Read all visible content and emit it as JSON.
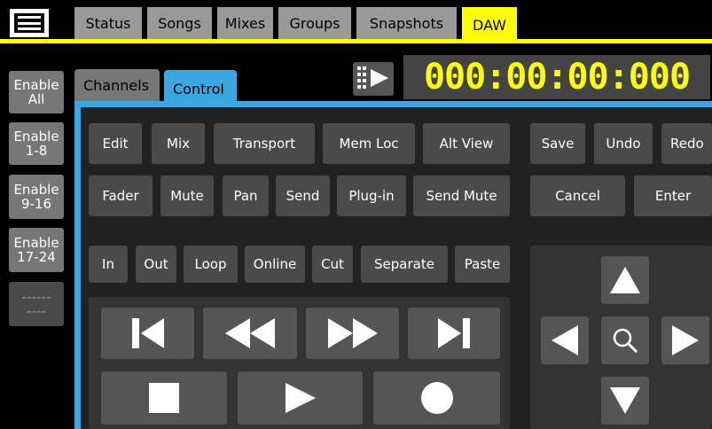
{
  "top_tabs": [
    "Status",
    "Songs",
    "Mixes",
    "Groups",
    "Snapshots",
    "DAW"
  ],
  "active_top_tab": "DAW",
  "left_buttons": [
    "Enable\nAll",
    "Enable\n1-8",
    "Enable\n9-16",
    "Enable\n17-24",
    "------\n----"
  ],
  "sub_tabs": [
    "Channels",
    "Control"
  ],
  "active_sub_tab": "Control",
  "timecode": "000:00:00:000",
  "row1": [
    "Edit",
    "Mix",
    "Transport",
    "Mem Loc",
    "Alt View"
  ],
  "row1_right": [
    "Save",
    "Undo",
    "Redo"
  ],
  "row2": [
    "Fader",
    "Mute",
    "Pan",
    "Send",
    "Plug-in",
    "Send Mute"
  ],
  "row2_right": [
    "Cancel",
    "Enter"
  ],
  "row3": [
    "In",
    "Out",
    "Loop",
    "Online",
    "Cut",
    "Separate",
    "Paste"
  ],
  "colors": {
    "accent_yellow": "#ffff00",
    "accent_blue": "#3aa8e0",
    "button_gray": "#4a4a4a",
    "background": "#000000"
  },
  "icons": {
    "transport": [
      "rewind-to-start-icon",
      "rewind-icon",
      "fast-forward-icon",
      "skip-to-end-icon",
      "stop-icon",
      "play-icon",
      "record-icon"
    ],
    "nav": [
      "arrow-up-icon",
      "arrow-left-icon",
      "zoom-icon",
      "arrow-right-icon",
      "arrow-down-icon"
    ]
  }
}
